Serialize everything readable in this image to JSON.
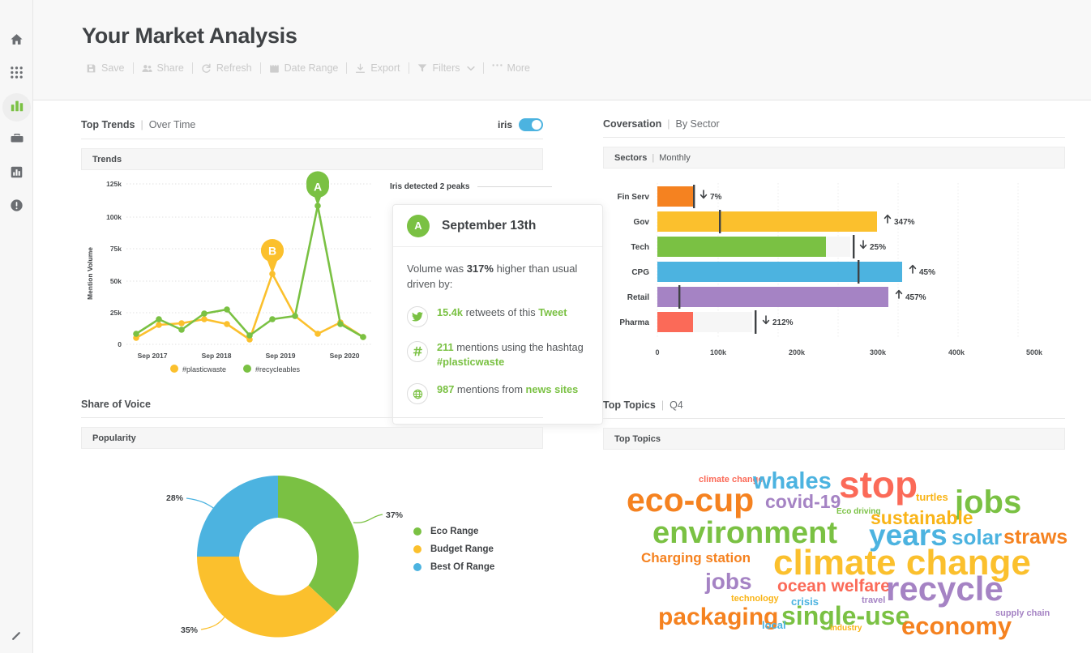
{
  "sidebar": {
    "items": [
      {
        "name": "home",
        "icon": "home-icon",
        "active": false
      },
      {
        "name": "apps",
        "icon": "grid-apps-icon",
        "active": false
      },
      {
        "name": "analytics",
        "icon": "bar-chart-icon",
        "active": true
      },
      {
        "name": "briefcase",
        "icon": "briefcase-icon",
        "active": false
      },
      {
        "name": "reports",
        "icon": "report-chart-icon",
        "active": false
      },
      {
        "name": "alerts",
        "icon": "alert-circle-icon",
        "active": false
      }
    ],
    "collapse": {
      "label": "collapse-handle",
      "icon": "resize-handle-icon"
    }
  },
  "header": {
    "title": "Your Market Analysis",
    "toolbar": [
      {
        "label": "Save",
        "icon": "save-icon"
      },
      {
        "label": "Share",
        "icon": "share-users-icon"
      },
      {
        "label": "Refresh",
        "icon": "refresh-icon"
      },
      {
        "label": "Date Range",
        "icon": "calendar-icon"
      },
      {
        "label": "Export",
        "icon": "download-icon"
      },
      {
        "label": "Filters",
        "icon": "filter-icon",
        "caret": true
      },
      {
        "label": "More",
        "icon": "ellipsis-icon"
      }
    ]
  },
  "panels": {
    "top_trends": {
      "title": "Top Trends",
      "subtitle": "Over Time",
      "sub_bar": "Trends",
      "iris_label": "iris",
      "iris_enabled": true
    },
    "conversation": {
      "title": "Coversation",
      "subtitle": "By Sector",
      "sub_bar_title": "Sectors",
      "sub_bar_sub": "Monthly"
    },
    "share_of_voice": {
      "title": "Share of Voice",
      "sub_bar": "Popularity"
    },
    "top_topics": {
      "title": "Top Topics",
      "subtitle": "Q4",
      "sub_bar": "Top Topics"
    }
  },
  "iris_callout": {
    "peaks_label": "Iris detected 2 peaks",
    "peak_letter": "A",
    "date": "September 13th",
    "lead_prefix": "Volume was ",
    "lead_value": "317%",
    "lead_suffix": " higher than usual driven by:",
    "items": [
      {
        "icon": "twitter-icon",
        "value": "15.4k",
        "text": " retweets of this ",
        "link": "Tweet"
      },
      {
        "icon": "hashtag-icon",
        "value": "211",
        "text": " mentions using the hashtag ",
        "link": "#plasticwaste"
      },
      {
        "icon": "globe-icon",
        "value": "987",
        "text": " mentions from ",
        "link": "news sites"
      }
    ]
  },
  "colors": {
    "green": "#7ac143",
    "yellow": "#fbc02d",
    "amber": "#f9b417",
    "blue": "#4cb3e0",
    "orange": "#f58220",
    "purple": "#a583c4",
    "red": "#fb6a58",
    "accent_green": "#7ac143"
  },
  "chart_data": [
    {
      "type": "line",
      "title": "Trends",
      "xlabel": "",
      "ylabel": "Mention Volume",
      "ylim": [
        0,
        130000
      ],
      "yticks": [
        0,
        25000,
        50000,
        75000,
        100000,
        125000
      ],
      "ytick_labels": [
        "0",
        "25k",
        "50k",
        "75k",
        "100k",
        "125k"
      ],
      "xtick_labels": [
        "Sep 2017",
        "Sep 2018",
        "Sep 2019",
        "Sep 2020"
      ],
      "grid": true,
      "legend": [
        "#plasticwaste",
        "#recycleables"
      ],
      "legend_position": "bottom",
      "series": [
        {
          "name": "#plasticwaste",
          "color": "#fbc02d",
          "values": [
            5000,
            15500,
            16500,
            19500,
            16000,
            3500,
            55000,
            22000,
            8500,
            17000,
            5500
          ]
        },
        {
          "name": "#recycleables",
          "color": "#7ac143",
          "values": [
            8500,
            19500,
            11500,
            24500,
            27000,
            7000,
            19500,
            22000,
            108000,
            16000,
            5500
          ]
        }
      ],
      "annotations": [
        {
          "label": "A",
          "series": "#recycleables",
          "index": 8,
          "value": 108000,
          "color": "#7ac143"
        },
        {
          "label": "B",
          "series": "#plasticwaste",
          "index": 6,
          "value": 55000,
          "color": "#fbc02d"
        }
      ]
    },
    {
      "type": "bar",
      "title": "Sectors | Monthly",
      "orientation": "horizontal",
      "categories": [
        "Fin Serv",
        "Gov",
        "Tech",
        "CPG",
        "Retail",
        "Pharma"
      ],
      "values": [
        60000,
        320000,
        245000,
        358000,
        337000,
        60000
      ],
      "track_values": [
        60000,
        320000,
        272000,
        358000,
        337000,
        155000
      ],
      "marker_values": [
        60000,
        103000,
        272000,
        303000,
        36000,
        155000
      ],
      "deltas": [
        "7%",
        "347%",
        "25%",
        "45%",
        "457%",
        "212%"
      ],
      "delta_dirs": [
        "down",
        "up",
        "down",
        "up",
        "up",
        "down"
      ],
      "colors": [
        "#f58220",
        "#fbc02d",
        "#7ac143",
        "#4cb3e0",
        "#a583c4",
        "#fb6a58"
      ],
      "xticks": [
        0,
        100000,
        200000,
        300000,
        400000,
        500000
      ],
      "xtick_labels": [
        "0",
        "100k",
        "200k",
        "300k",
        "400k",
        "500k"
      ],
      "xlim": [
        0,
        520000
      ],
      "grid": true
    },
    {
      "type": "pie",
      "title": "Popularity",
      "subtype": "donut",
      "labels": [
        "Eco Range",
        "Budget Range",
        "Best Of Range"
      ],
      "values": [
        37,
        35,
        28
      ],
      "value_labels": [
        "37%",
        "35%",
        "28%"
      ],
      "colors": [
        "#7ac143",
        "#fbc02d",
        "#4cb3e0"
      ],
      "legend_position": "right"
    },
    {
      "type": "wordcloud",
      "title": "Top Topics",
      "words": [
        {
          "text": "climate change",
          "size": 11,
          "color": "#fb6a58",
          "x": 118,
          "y": 31
        },
        {
          "text": "whales",
          "size": 29,
          "color": "#4cb3e0",
          "x": 185,
          "y": 24
        },
        {
          "text": "stop",
          "size": 46,
          "color": "#fb6a58",
          "x": 291,
          "y": 19
        },
        {
          "text": "turtles",
          "size": 13,
          "color": "#f9b417",
          "x": 386,
          "y": 51
        },
        {
          "text": "jobs",
          "size": 40,
          "color": "#7ac143",
          "x": 434,
          "y": 44
        },
        {
          "text": "eco-cup",
          "size": 41,
          "color": "#f58220",
          "x": 29,
          "y": 41
        },
        {
          "text": "covid-19",
          "size": 23,
          "color": "#a583c4",
          "x": 200,
          "y": 52
        },
        {
          "text": "Eco driving",
          "size": 10,
          "color": "#7ac143",
          "x": 288,
          "y": 71
        },
        {
          "text": "sustainable",
          "size": 23,
          "color": "#f9b417",
          "x": 330,
          "y": 72
        },
        {
          "text": "environment",
          "size": 38,
          "color": "#7ac143",
          "x": 61,
          "y": 83
        },
        {
          "text": "years",
          "size": 37,
          "color": "#4cb3e0",
          "x": 328,
          "y": 86
        },
        {
          "text": "solar",
          "size": 26,
          "color": "#4cb3e0",
          "x": 430,
          "y": 94
        },
        {
          "text": "straws",
          "size": 25,
          "color": "#f58220",
          "x": 494,
          "y": 95
        },
        {
          "text": "Charging station",
          "size": 17,
          "color": "#f58220",
          "x": 47,
          "y": 124
        },
        {
          "text": "climate change",
          "size": 44,
          "color": "#fbc02d",
          "x": 210,
          "y": 117
        },
        {
          "text": "jobs",
          "size": 28,
          "color": "#a583c4",
          "x": 126,
          "y": 148
        },
        {
          "text": "ocean welfare",
          "size": 21,
          "color": "#fb6a58",
          "x": 215,
          "y": 157
        },
        {
          "text": "recycle",
          "size": 42,
          "color": "#a583c4",
          "x": 349,
          "y": 150
        },
        {
          "text": "technology",
          "size": 11,
          "color": "#f9b417",
          "x": 158,
          "y": 178
        },
        {
          "text": "crisis",
          "size": 13,
          "color": "#4cb3e0",
          "x": 232,
          "y": 180
        },
        {
          "text": "travel",
          "size": 11,
          "color": "#a583c4",
          "x": 319,
          "y": 180
        },
        {
          "text": "packaging",
          "size": 30,
          "color": "#f58220",
          "x": 68,
          "y": 191
        },
        {
          "text": "single-use",
          "size": 32,
          "color": "#7ac143",
          "x": 220,
          "y": 188
        },
        {
          "text": "economy",
          "size": 31,
          "color": "#f58220",
          "x": 368,
          "y": 201
        },
        {
          "text": "supply chain",
          "size": 11,
          "color": "#a583c4",
          "x": 484,
          "y": 196
        },
        {
          "text": "local",
          "size": 13,
          "color": "#4cb3e0",
          "x": 196,
          "y": 209
        },
        {
          "text": "industry",
          "size": 10,
          "color": "#f9b417",
          "x": 280,
          "y": 215
        }
      ]
    }
  ]
}
